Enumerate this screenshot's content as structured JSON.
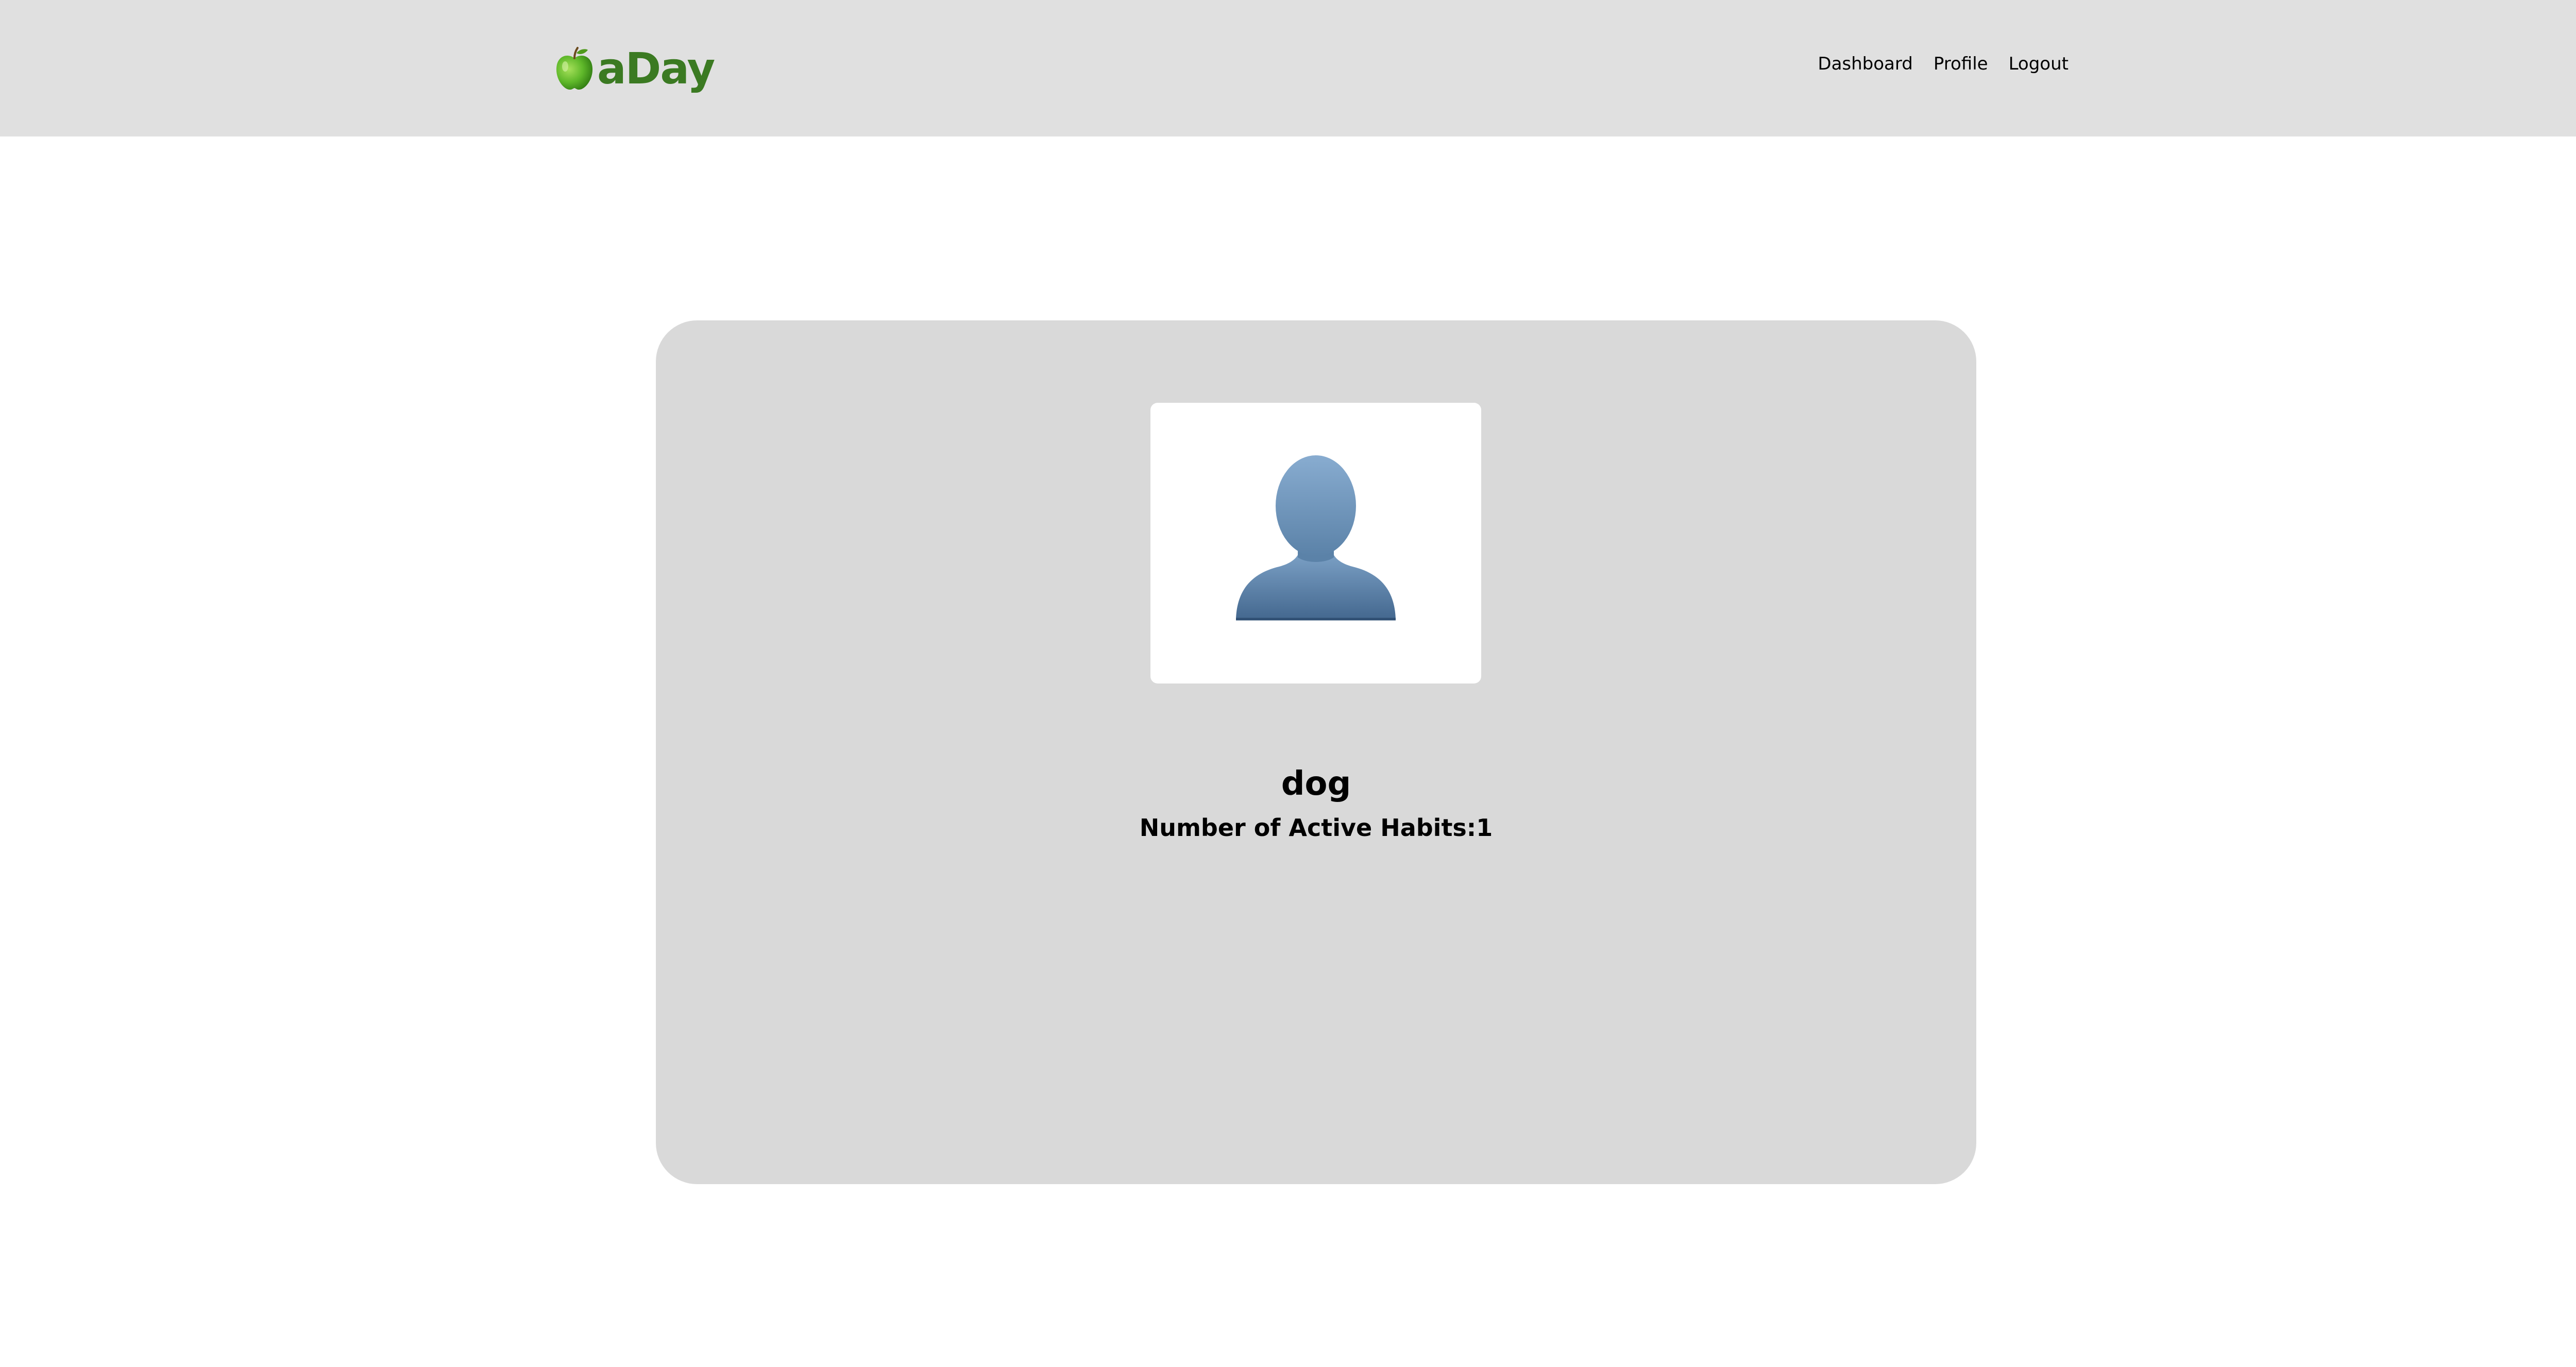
{
  "header": {
    "brand_icon": "green-apple-icon",
    "brand_text": "aDay",
    "brand_color": "#3b7a22",
    "background": "#e0e0e0",
    "nav": [
      {
        "label": "Dashboard"
      },
      {
        "label": "Profile"
      },
      {
        "label": "Logout"
      }
    ]
  },
  "profile": {
    "avatar_icon": "user-silhouette-icon",
    "avatar_color": "#5b82a8",
    "username": "dog",
    "active_habits_label": "Number of Active Habits:",
    "active_habits_count": "1",
    "card_background": "#d9d9d9"
  }
}
